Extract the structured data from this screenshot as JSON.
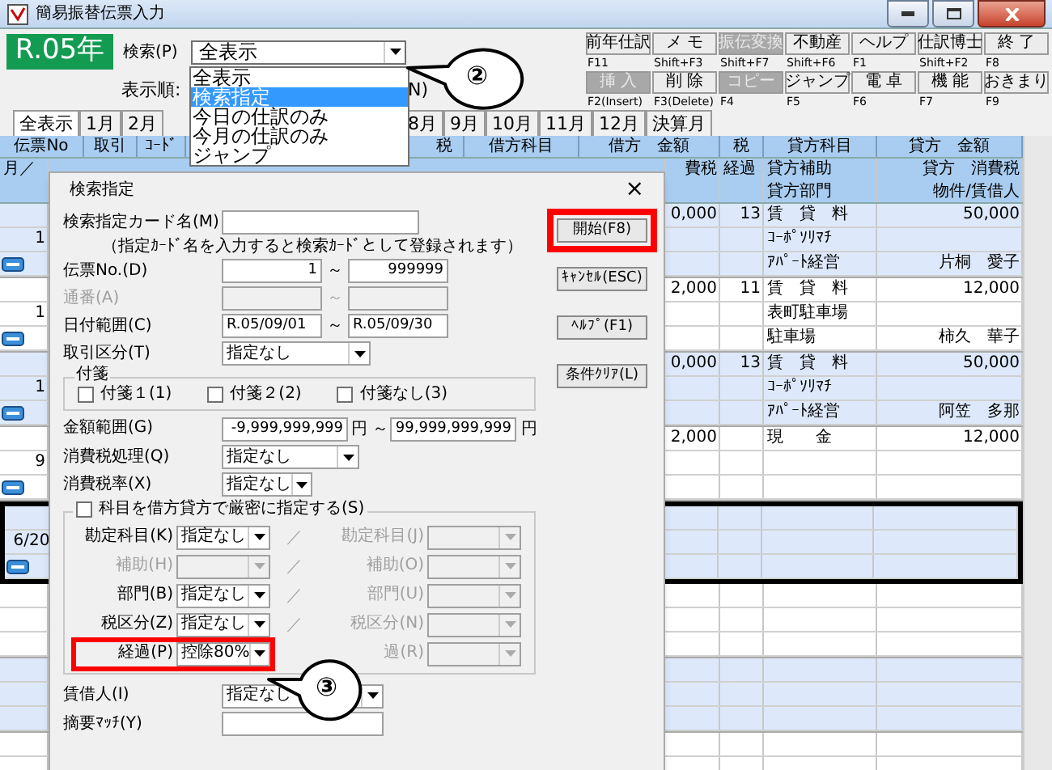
{
  "window": {
    "title": "簡易振替伝票入力"
  },
  "era_badge": "R.05年",
  "search": {
    "label": "検索(P)",
    "value": "全表示"
  },
  "search_dropdown": [
    {
      "label": "全表示",
      "selected": false
    },
    {
      "label": "検索指定",
      "selected": true
    },
    {
      "label": "今日の仕訳のみ",
      "selected": false
    },
    {
      "label": "今月の仕訳のみ",
      "selected": false
    },
    {
      "label": "ジャンプ",
      "selected": false
    }
  ],
  "sort": {
    "label": "表示順:",
    "cut_text": "N)"
  },
  "toolbar_row1": [
    {
      "label": "前年仕訳",
      "key": "F11",
      "disabled": false
    },
    {
      "label": "メ モ",
      "key": "Shift+F3",
      "disabled": false
    },
    {
      "label": "振伝変換",
      "key": "Shift+F7",
      "disabled": true
    },
    {
      "label": "不動産",
      "key": "Shift+F6",
      "disabled": false
    },
    {
      "label": "ヘルプ",
      "key": "F1",
      "disabled": false
    },
    {
      "label": "仕訳博士",
      "key": "Shift+F2",
      "disabled": false
    },
    {
      "label": "終 了",
      "key": "F8",
      "disabled": false
    }
  ],
  "toolbar_row2": [
    {
      "label": "挿 入",
      "key": "F2(Insert)",
      "disabled": true
    },
    {
      "label": "削 除",
      "key": "F3(Delete)",
      "disabled": false
    },
    {
      "label": "コピー",
      "key": "F4",
      "disabled": true
    },
    {
      "label": "ジャンプ",
      "key": "F5",
      "disabled": false
    },
    {
      "label": "電 卓",
      "key": "F6",
      "disabled": false
    },
    {
      "label": "機 能",
      "key": "F7",
      "disabled": false
    },
    {
      "label": "おきまり",
      "key": "F9",
      "disabled": false
    }
  ],
  "month_tabs_left": [
    {
      "label": "全表示",
      "selected": true
    },
    {
      "label": "1月",
      "selected": false
    },
    {
      "label": "2月",
      "selected": false
    }
  ],
  "month_tabs_right": [
    {
      "label": "8月",
      "selected": false
    },
    {
      "label": "9月",
      "selected": false
    },
    {
      "label": "10月",
      "selected": false
    },
    {
      "label": "11月",
      "selected": false
    },
    {
      "label": "12月",
      "selected": false
    },
    {
      "label": "決算月",
      "selected": false
    }
  ],
  "table": {
    "header_left": [
      "伝票No",
      "取引",
      "ｺｰﾄﾞ"
    ],
    "header_right": [
      "税",
      "借方科目",
      "借方　金額",
      "税",
      "貸方科目",
      "貸方　金額"
    ],
    "header_row2": {
      "strip": "月／",
      "amount": "費税",
      "tax": "経過",
      "account": "貸方補助",
      "amount2": "貸方　消費税"
    },
    "header_row3": {
      "account": "貸方部門",
      "amount2": "物件/賃借人"
    },
    "groups": [
      {
        "selected": false,
        "line1": {
          "amount": "0,000",
          "tax": "13",
          "account": "賃　貸　料",
          "amount2": "50,000"
        },
        "line2": {
          "strip": "1",
          "account": "ｺｰﾎﾟｿﾘﾏﾁ"
        },
        "line3": {
          "memo": true,
          "account": "ｱﾊﾟｰﾄ経営",
          "amount2": "片桐　愛子"
        }
      },
      {
        "selected": false,
        "line1": {
          "amount": "2,000",
          "tax": "11",
          "account": "賃　貸　料",
          "amount2": "12,000"
        },
        "line2": {
          "strip": "1",
          "account": "表町駐車場"
        },
        "line3": {
          "memo": true,
          "account": "駐車場",
          "amount2": "柿久　華子"
        }
      },
      {
        "selected": false,
        "line1": {
          "amount": "0,000",
          "tax": "13",
          "account": "賃　貸　料",
          "amount2": "50,000"
        },
        "line2": {
          "strip": "1",
          "account": "ｺｰﾎﾟｿﾘﾏﾁ"
        },
        "line3": {
          "memo": true,
          "account": "ｱﾊﾟｰﾄ経営",
          "amount2": "阿笠　多那"
        }
      },
      {
        "selected": false,
        "line1": {
          "amount": "2,000",
          "account": "現　　金",
          "amount2": "12,000"
        },
        "line2": {
          "strip": "9"
        },
        "line3": {
          "memo": true
        }
      },
      {
        "selected": true,
        "line2": {
          "strip": "6/20"
        },
        "line3": {
          "memo": true
        }
      },
      {
        "selected": false
      },
      {
        "selected": false
      },
      {
        "selected": false
      }
    ]
  },
  "dialog": {
    "title": "検索指定",
    "close": "×",
    "card_name": {
      "label": "検索指定カード名(M)"
    },
    "note": "（指定ｶｰﾄﾞ名を入力すると検索ｶｰﾄﾞとして登録されます）",
    "ranges": [
      {
        "label": "伝票No.(D)",
        "from": "1",
        "separator": "～",
        "to": "999999",
        "disabled": false
      },
      {
        "label": "通番(A)",
        "separator": "～",
        "disabled": true
      },
      {
        "label": "日付範囲(C)",
        "from": "R.05/09/01",
        "separator": "～",
        "to": "R.05/09/30",
        "disabled": false
      }
    ],
    "trade_type": {
      "label": "取引区分(T)",
      "value": "指定なし"
    },
    "tags": {
      "title": "付箋",
      "items": [
        {
          "label": "付箋１(1)",
          "checked": false
        },
        {
          "label": "付箋２(2)",
          "checked": false
        },
        {
          "label": "付箋なし(3)",
          "checked": false
        }
      ]
    },
    "amount_range": {
      "label": "金額範囲(G)",
      "from": "-9,999,999,999",
      "from_unit": "円",
      "separator": "～",
      "to": "99,999,999,999",
      "to_unit": "円"
    },
    "tax_processing": {
      "label": "消費税処理(Q)",
      "value": "指定なし"
    },
    "tax_rate": {
      "label": "消費税率(X)",
      "value": "指定なし"
    },
    "strict": {
      "label": "科目を借方貸方で厳密に指定する(S)",
      "checked": false,
      "rows": [
        {
          "left_label": "勘定科目(K)",
          "left_value": "指定なし",
          "left_disabled": false,
          "separator": "／",
          "right_label": "勘定科目(J)",
          "right_disabled": true,
          "highlighted": false
        },
        {
          "left_label": "補助(H)",
          "left_disabled": true,
          "separator": "／",
          "right_label": "補助(O)",
          "right_disabled": true,
          "highlighted": false
        },
        {
          "left_label": "部門(B)",
          "left_value": "指定なし",
          "left_disabled": false,
          "separator": "／",
          "right_label": "部門(U)",
          "right_disabled": true,
          "highlighted": false
        },
        {
          "left_label": "税区分(Z)",
          "left_value": "指定なし",
          "left_disabled": false,
          "separator": "／",
          "right_label": "税区分(N)",
          "right_disabled": true,
          "highlighted": false
        },
        {
          "left_label": "経過(P)",
          "left_value": "控除80%",
          "left_disabled": false,
          "right_label": "過(R)",
          "right_disabled": true,
          "highlighted": true
        }
      ]
    },
    "lessee": {
      "label": "賃借人(I)",
      "value": "指定なし"
    },
    "summary_match": {
      "label": "摘要ﾏｯﾁ(Y)"
    },
    "buttons": [
      {
        "label": "開始(F8)",
        "highlighted": true
      },
      {
        "label": "ｷｬﾝｾﾙ(ESC)",
        "highlighted": false
      },
      {
        "label": "ﾍﾙﾌﾟ(F1)",
        "highlighted": false
      },
      {
        "label": "条件ｸﾘｱ(L)",
        "highlighted": false
      }
    ]
  },
  "callouts": [
    {
      "label": "②"
    },
    {
      "label": "③"
    }
  ]
}
